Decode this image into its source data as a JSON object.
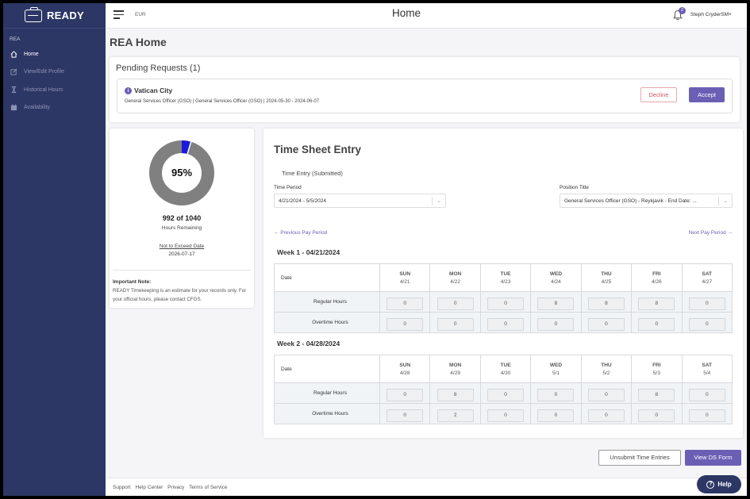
{
  "sidebar": {
    "brand": "READY",
    "section": "REA",
    "items": [
      {
        "label": "Home",
        "icon": "home-icon"
      },
      {
        "label": "View/Edit Profile",
        "icon": "edit-icon"
      },
      {
        "label": "Historical Hours",
        "icon": "hourglass-icon"
      },
      {
        "label": "Availability",
        "icon": "calendar-icon"
      }
    ]
  },
  "topbar": {
    "region": "EUR",
    "title": "Home",
    "notification_count": "2",
    "user": "Steph CryderSM"
  },
  "page_title": "REA Home",
  "pending": {
    "title": "Pending Requests (1)",
    "city": "Vatican City",
    "detail": "General Services Officer (GSO) | General Services Officer (GSO) | 2024-05-30 - 2024-06-07",
    "decline": "Decline",
    "accept": "Accept"
  },
  "hours": {
    "percent_label": "95%",
    "used_fraction": 0.046,
    "count": "992 of 1040",
    "count_label": "Hours Remaining",
    "nte_label": "Not to Exceed Date",
    "nte_date": "2026-07-17",
    "note_title": "Important Note:",
    "note_text": "READY Timekeeping is an estimate for your records only. For your official hours, please contact CFGS.",
    "colors": {
      "remaining": "#808080",
      "used": "#1a1adb"
    }
  },
  "timesheet": {
    "title": "Time Sheet Entry",
    "subtitle": "Time Entry (Submitted)",
    "time_period_label": "Time Period",
    "time_period_value": "4/21/2024 - 5/5/2024",
    "position_label": "Position Title",
    "position_value": "General Services Officer (GSO) - Reykjavik - End Date: ...",
    "prev": "← Previous Pay Period",
    "next": "Next Pay Period →",
    "date_label": "Date",
    "regular_label": "Regular Hours",
    "overtime_label": "Overtime Hours",
    "weeks": [
      {
        "title": "Week 1 - 04/21/2024",
        "days": [
          {
            "name": "SUN",
            "date": "4/21"
          },
          {
            "name": "MON",
            "date": "4/22"
          },
          {
            "name": "TUE",
            "date": "4/23"
          },
          {
            "name": "WED",
            "date": "4/24"
          },
          {
            "name": "THU",
            "date": "4/25"
          },
          {
            "name": "FRI",
            "date": "4/26"
          },
          {
            "name": "SAT",
            "date": "4/27"
          }
        ],
        "regular": [
          "0",
          "0",
          "0",
          "8",
          "8",
          "8",
          "0"
        ],
        "overtime": [
          "0",
          "0",
          "0",
          "0",
          "0",
          "0",
          "0"
        ]
      },
      {
        "title": "Week 2 - 04/28/2024",
        "days": [
          {
            "name": "SUN",
            "date": "4/28"
          },
          {
            "name": "MON",
            "date": "4/29"
          },
          {
            "name": "TUE",
            "date": "4/30"
          },
          {
            "name": "WED",
            "date": "5/1"
          },
          {
            "name": "THU",
            "date": "5/2"
          },
          {
            "name": "FRI",
            "date": "5/3"
          },
          {
            "name": "SAT",
            "date": "5/4"
          }
        ],
        "regular": [
          "0",
          "8",
          "0",
          "0",
          "0",
          "8",
          "0"
        ],
        "overtime": [
          "0",
          "2",
          "0",
          "0",
          "0",
          "0",
          "0"
        ]
      }
    ]
  },
  "actions": {
    "unsubmit": "Unsubmit Time Entries",
    "view_ds": "View DS Form"
  },
  "footer": {
    "links": [
      "Support",
      "Help Center",
      "Privacy",
      "Terms of Service"
    ]
  },
  "help": "Help",
  "accent": "#6b5fb5",
  "sidebar_color": "#2d3765"
}
